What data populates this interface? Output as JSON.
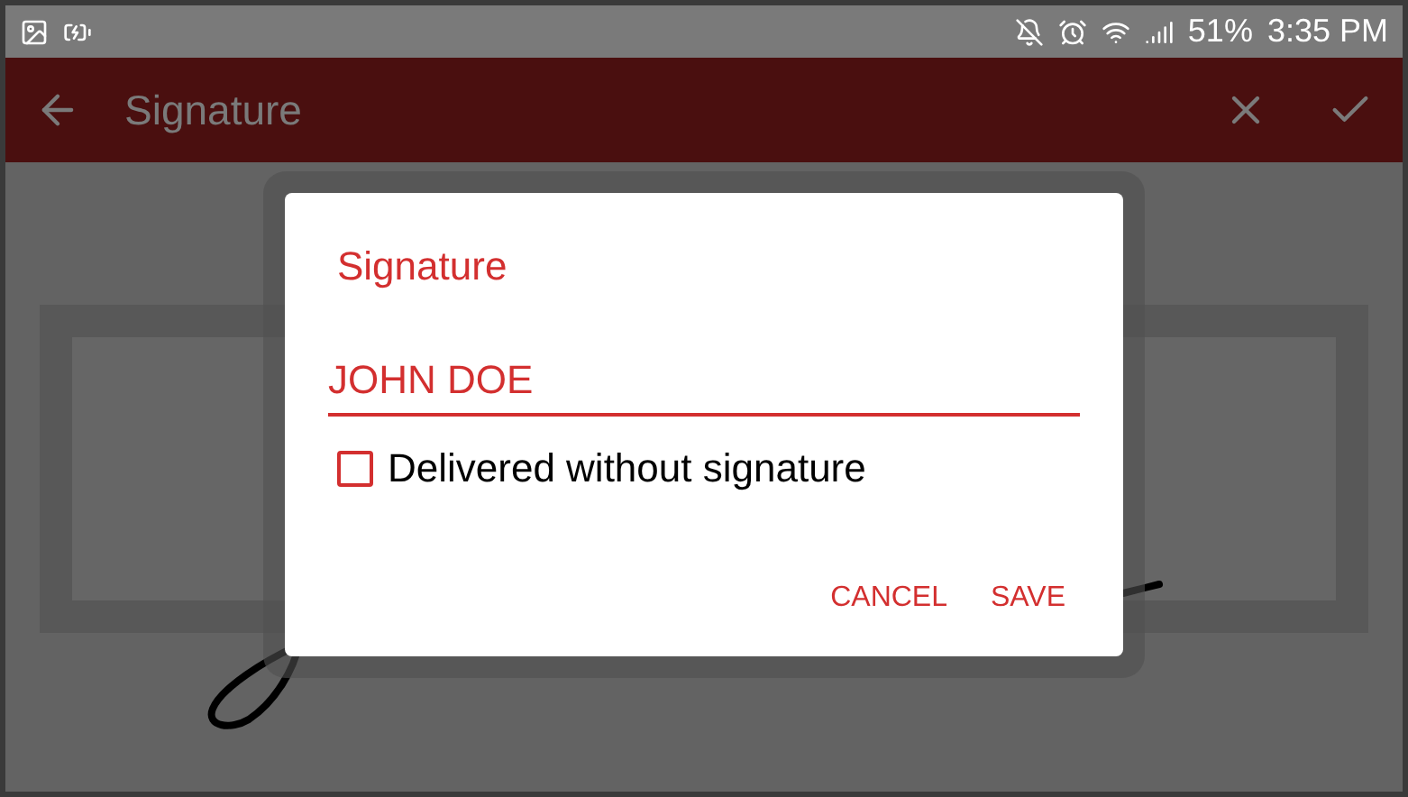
{
  "status_bar": {
    "battery": "51%",
    "time": "3:35 PM"
  },
  "app_bar": {
    "title": "Signature"
  },
  "dialog": {
    "title": "Signature",
    "name_field": {
      "value": "JOHN DOE"
    },
    "checkbox": {
      "label": "Delivered without signature",
      "checked": false
    },
    "buttons": [
      "CANCEL",
      "SAVE"
    ]
  }
}
